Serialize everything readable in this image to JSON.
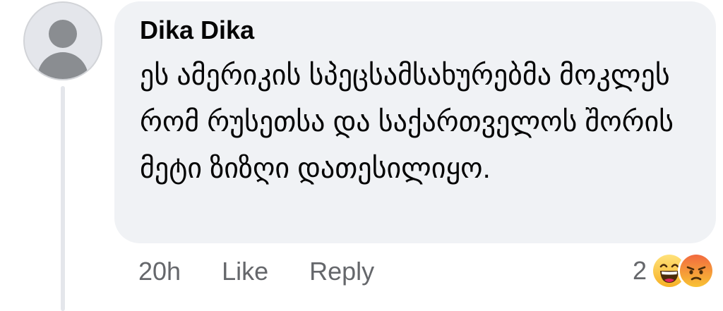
{
  "comment": {
    "author": "Dika Dika",
    "text": "ეს ამერიკის სპეცსამსახურებმა მოკლეს რომ რუსეთსა და საქართველოს შორის მეტი ზიზღი დათესილიყო."
  },
  "actions": {
    "time": "20h",
    "like_label": "Like",
    "reply_label": "Reply"
  },
  "reactions": {
    "count": "2",
    "types": [
      "haha-icon",
      "angry-icon"
    ]
  },
  "colors": {
    "bubble": "#f0f2f5",
    "text": "#050505",
    "secondary_text": "#65676b",
    "avatar_bg": "#e4e6eb"
  }
}
